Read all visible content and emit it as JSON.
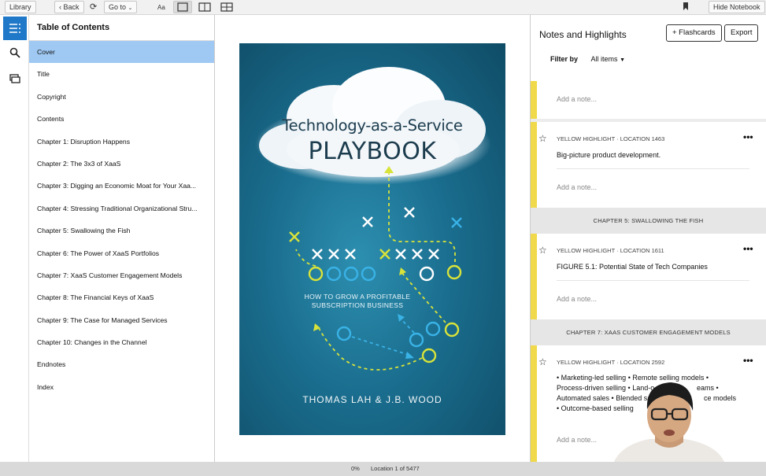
{
  "topbar": {
    "library": "Library",
    "back": "Back",
    "goto": "Go to",
    "font": "Aa",
    "hide_notebook": "Hide Notebook"
  },
  "rail": {
    "icons": [
      "table-of-contents-icon",
      "search-icon",
      "flashcards-icon"
    ]
  },
  "toc": {
    "title": "Table of Contents",
    "items": [
      "Cover",
      "Title",
      "Copyright",
      "Contents",
      "Chapter 1: Disruption Happens",
      "Chapter 2: The 3x3 of XaaS",
      "Chapter 3: Digging an Economic Moat for Your Xaa...",
      "Chapter 4: Stressing Traditional Organizational Stru...",
      "Chapter 5: Swallowing the Fish",
      "Chapter 6: The Power of XaaS Portfolios",
      "Chapter 7: XaaS Customer Engagement Models",
      "Chapter 8: The Financial Keys of XaaS",
      "Chapter 9: The Case for Managed Services",
      "Chapter 10: Changes in the Channel",
      "Endnotes",
      "Index"
    ],
    "selected_index": 0
  },
  "cover": {
    "title_line1": "Technology-as-a-Service",
    "title_line2": "PLAYBOOK",
    "subtitle_line1": "HOW TO GROW A PROFITABLE",
    "subtitle_line2": "SUBSCRIPTION BUSINESS",
    "authors": "THOMAS LAH & J.B. WOOD"
  },
  "notebook": {
    "title": "Notes and Highlights",
    "flashcards_button": "+ Flashcards",
    "export_button": "Export",
    "filter_label": "Filter by",
    "filter_value": "All items",
    "add_note": "Add a note...",
    "highlights": [
      {
        "meta": "YELLOW HIGHLIGHT · LOCATION 1463",
        "text": "Big-picture product development."
      },
      {
        "meta": "YELLOW HIGHLIGHT · LOCATION 1611",
        "text": "FIGURE 5.1: Potential State of Tech Companies"
      },
      {
        "meta": "YELLOW HIGHLIGHT · LOCATION 2592",
        "lines": [
          "•   Marketing-led selling •   Remote selling models •",
          "Process-driven selling •   Land-o",
          "Automated sales •   Blended sa",
          "•   Outcome-based selling"
        ],
        "right_fragments": [
          "eams •",
          "ce models"
        ]
      }
    ],
    "sections": [
      "CHAPTER 5: SWALLOWING THE FISH",
      "CHAPTER 7: XAAS CUSTOMER ENGAGEMENT MODELS"
    ]
  },
  "status": {
    "percent": "0%",
    "location": "Location 1 of 5477"
  },
  "colors": {
    "highlight": "#f0d94a",
    "toc_selected": "#9fc9f3",
    "rail_active": "#1f78c8"
  }
}
